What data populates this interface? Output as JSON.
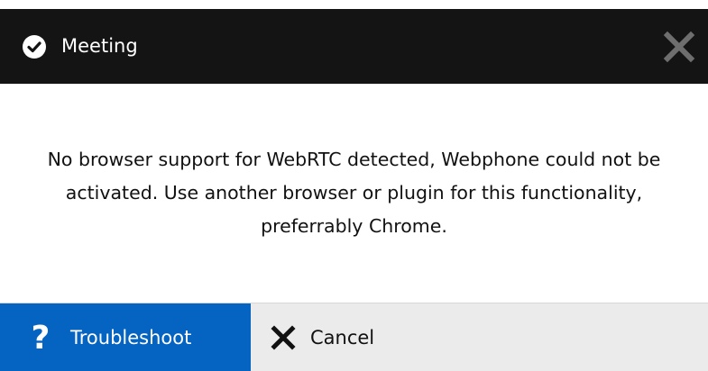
{
  "dialog": {
    "title": "Meeting",
    "title_icon": "check-circle-icon",
    "close_icon": "close-icon",
    "message": "No browser support for WebRTC detected, Webphone could not be activated. Use another browser or plugin for this functionality, preferrably Chrome.",
    "buttons": {
      "troubleshoot": {
        "label": "Troubleshoot",
        "icon": "question-icon",
        "icon_glyph": "?"
      },
      "cancel": {
        "label": "Cancel",
        "icon": "x-icon"
      }
    }
  },
  "colors": {
    "titlebar": "#141414",
    "primary_button": "#0563c1",
    "footer": "#ebebeb",
    "close_icon": "#6e6e6e"
  }
}
